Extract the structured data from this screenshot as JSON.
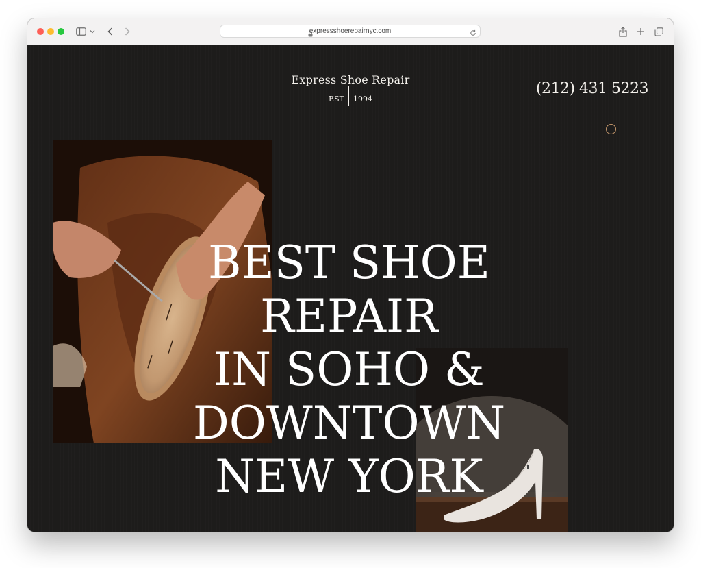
{
  "browser": {
    "url": "expressshoerepairnyc.com"
  },
  "site": {
    "brand_name": "Express Shoe Repair",
    "est_label": "EST",
    "est_year": "1994",
    "phone": "(212) 431 5223",
    "headline_lines": [
      "BEST SHOE REPAIR",
      "IN SOHO &",
      "DOWNTOWN",
      "NEW YORK"
    ]
  },
  "colors": {
    "page_bg": "#1d1c1b",
    "text": "#f4f1ec",
    "accent_ring": "#c89a6e"
  },
  "icons": {
    "sidebar": "sidebar-icon",
    "back": "chevron-left-icon",
    "forward": "chevron-right-icon",
    "lock": "lock-icon",
    "reload": "reload-icon",
    "share": "share-icon",
    "new_tab": "plus-icon",
    "tabs": "tabs-icon"
  }
}
